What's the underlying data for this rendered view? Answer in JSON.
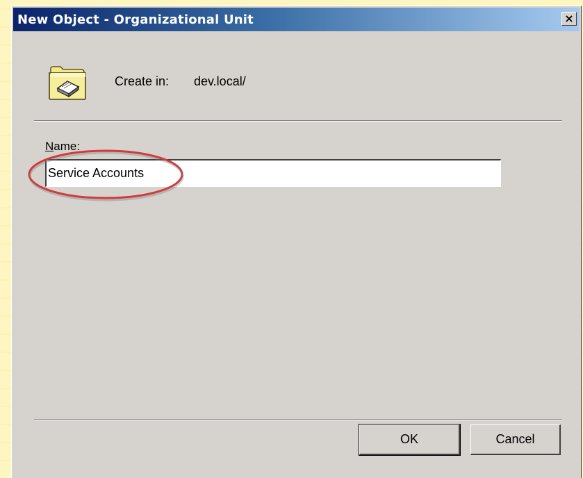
{
  "window": {
    "title": "New Object - Organizational Unit",
    "close_glyph": "×"
  },
  "header": {
    "icon": "folder-icon",
    "create_in_label": "Create in:",
    "create_in_value": "dev.local/"
  },
  "form": {
    "name_label_accel": "N",
    "name_label_rest": "ame:",
    "name_value": "Service Accounts",
    "highlight_color": "#d23a3a"
  },
  "buttons": {
    "ok_label": "OK",
    "cancel_label": "Cancel"
  },
  "colors": {
    "dialog_face": "#d6d3ce",
    "title_start": "#0a246a",
    "title_end": "#a6caf0",
    "backdrop": "#fdf5b8"
  }
}
